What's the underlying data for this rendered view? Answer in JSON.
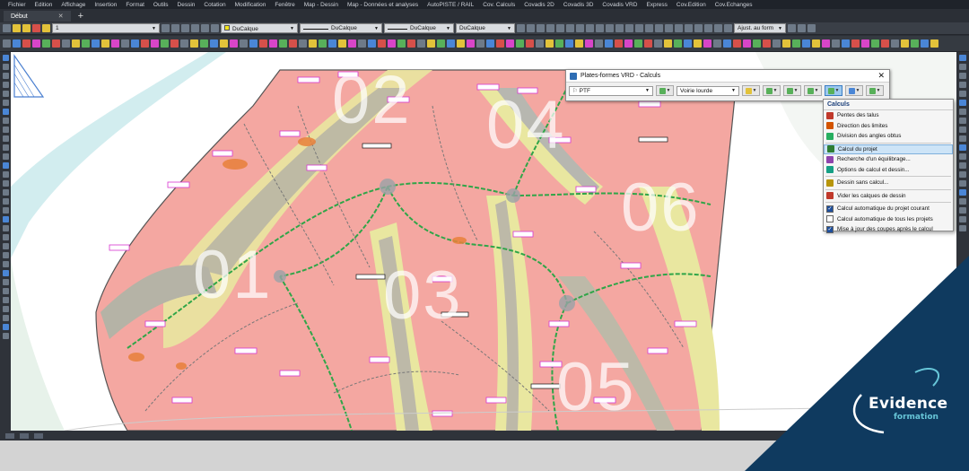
{
  "menubar": {
    "items": [
      "Fichier",
      "Edition",
      "Affichage",
      "Insertion",
      "Format",
      "Outils",
      "Dessin",
      "Cotation",
      "Modification",
      "Fenêtre",
      "Map - Dessin",
      "Map - Données et analyses",
      "AutoPISTE / RAIL",
      "Cov. Calculs",
      "Covadis 2D",
      "Covadis 3D",
      "Covadis VRD",
      "Express",
      "Cov.Edition",
      "Cov.Echanges"
    ]
  },
  "tabs": {
    "start_label": "Début",
    "close_glyph": "✕",
    "add_glyph": "+"
  },
  "toolbar1": {
    "layer_value": "1",
    "color_value": "DuCalque",
    "linetype_value": "DuCalque",
    "lineweight_value": "DuCalque",
    "plotstyle_value": "DuCalque",
    "zoom_value": "Ajust. au form"
  },
  "drawing": {
    "zones": [
      "01",
      "02",
      "03",
      "04",
      "05",
      "06"
    ]
  },
  "dialog": {
    "title": "Plates-formes VRD - Calculs",
    "close_glyph": "✕",
    "project_value": "PTF",
    "road_type_value": "Voirie lourde"
  },
  "calc_menu": {
    "header": "Calculs",
    "items": [
      {
        "label": "Pentes des talus",
        "color": "#c0392b"
      },
      {
        "label": "Direction des limites",
        "color": "#d35400"
      },
      {
        "label": "Division des angles obtus",
        "color": "#27ae60"
      },
      {
        "label": "Calcul du projet",
        "color": "#2e7d32"
      },
      {
        "label": "Recherche d'un équilibrage...",
        "color": "#8e44ad"
      },
      {
        "label": "Options de calcul et dessin...",
        "color": "#16a085"
      },
      {
        "label": "Dessin sans calcul...",
        "color": "#b7950b"
      },
      {
        "label": "Vider les calques de dessin",
        "color": "#c0392b"
      }
    ],
    "options": [
      {
        "label": "Calcul automatique du projet courant",
        "checked": true
      },
      {
        "label": "Calcul automatique de tous les projets",
        "checked": false
      },
      {
        "label": "Mise à jour des coupes après le calcul",
        "checked": true
      }
    ]
  },
  "brand": {
    "name": "Evidence",
    "tagline": "formation",
    "accent": "#0f3a5f",
    "accent2": "#67c6d8"
  }
}
